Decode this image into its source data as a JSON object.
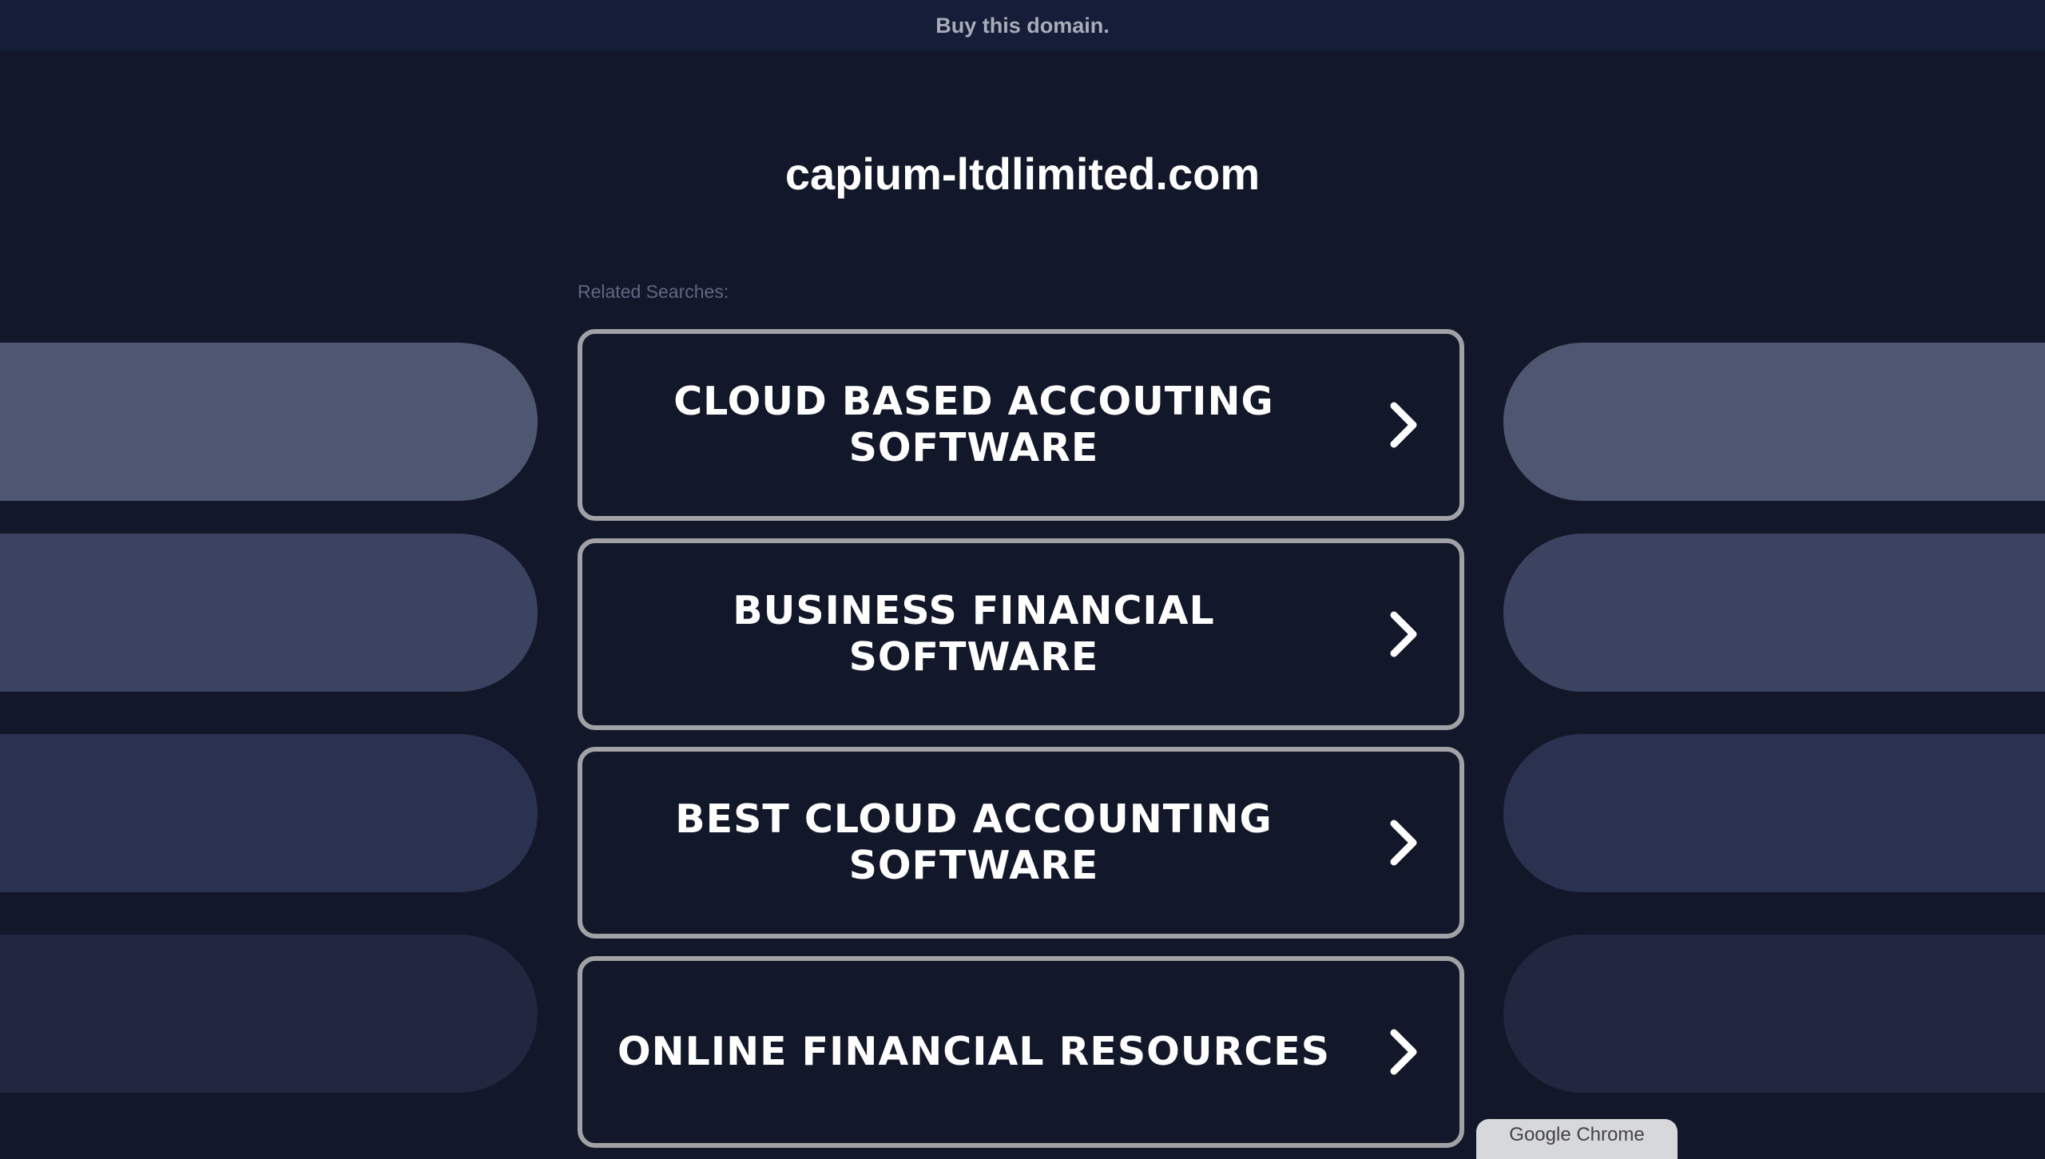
{
  "topbar": {
    "buy_label": "Buy this domain."
  },
  "domain": {
    "name": "capium-ltdlimited.com"
  },
  "related": {
    "label": "Related Searches:",
    "items": [
      {
        "label": "CLOUD BASED ACCOUTING SOFTWARE",
        "icon": "chevron-right-icon"
      },
      {
        "label": "BUSINESS FINANCIAL SOFTWARE",
        "icon": "chevron-right-icon"
      },
      {
        "label": "BEST CLOUD ACCOUNTING SOFTWARE",
        "icon": "chevron-right-icon"
      },
      {
        "label": "ONLINE FINANCIAL RESOURCES",
        "icon": "chevron-right-icon"
      }
    ]
  },
  "footer_tab": {
    "label": "Google Chrome"
  },
  "colors": {
    "background": "#121729",
    "topbar": "#151d38",
    "button_border": "#a2a2a6",
    "text": "#ffffff",
    "pill_shades": [
      "#4f5671",
      "#3b4360",
      "#2b3250",
      "#20273f"
    ]
  }
}
